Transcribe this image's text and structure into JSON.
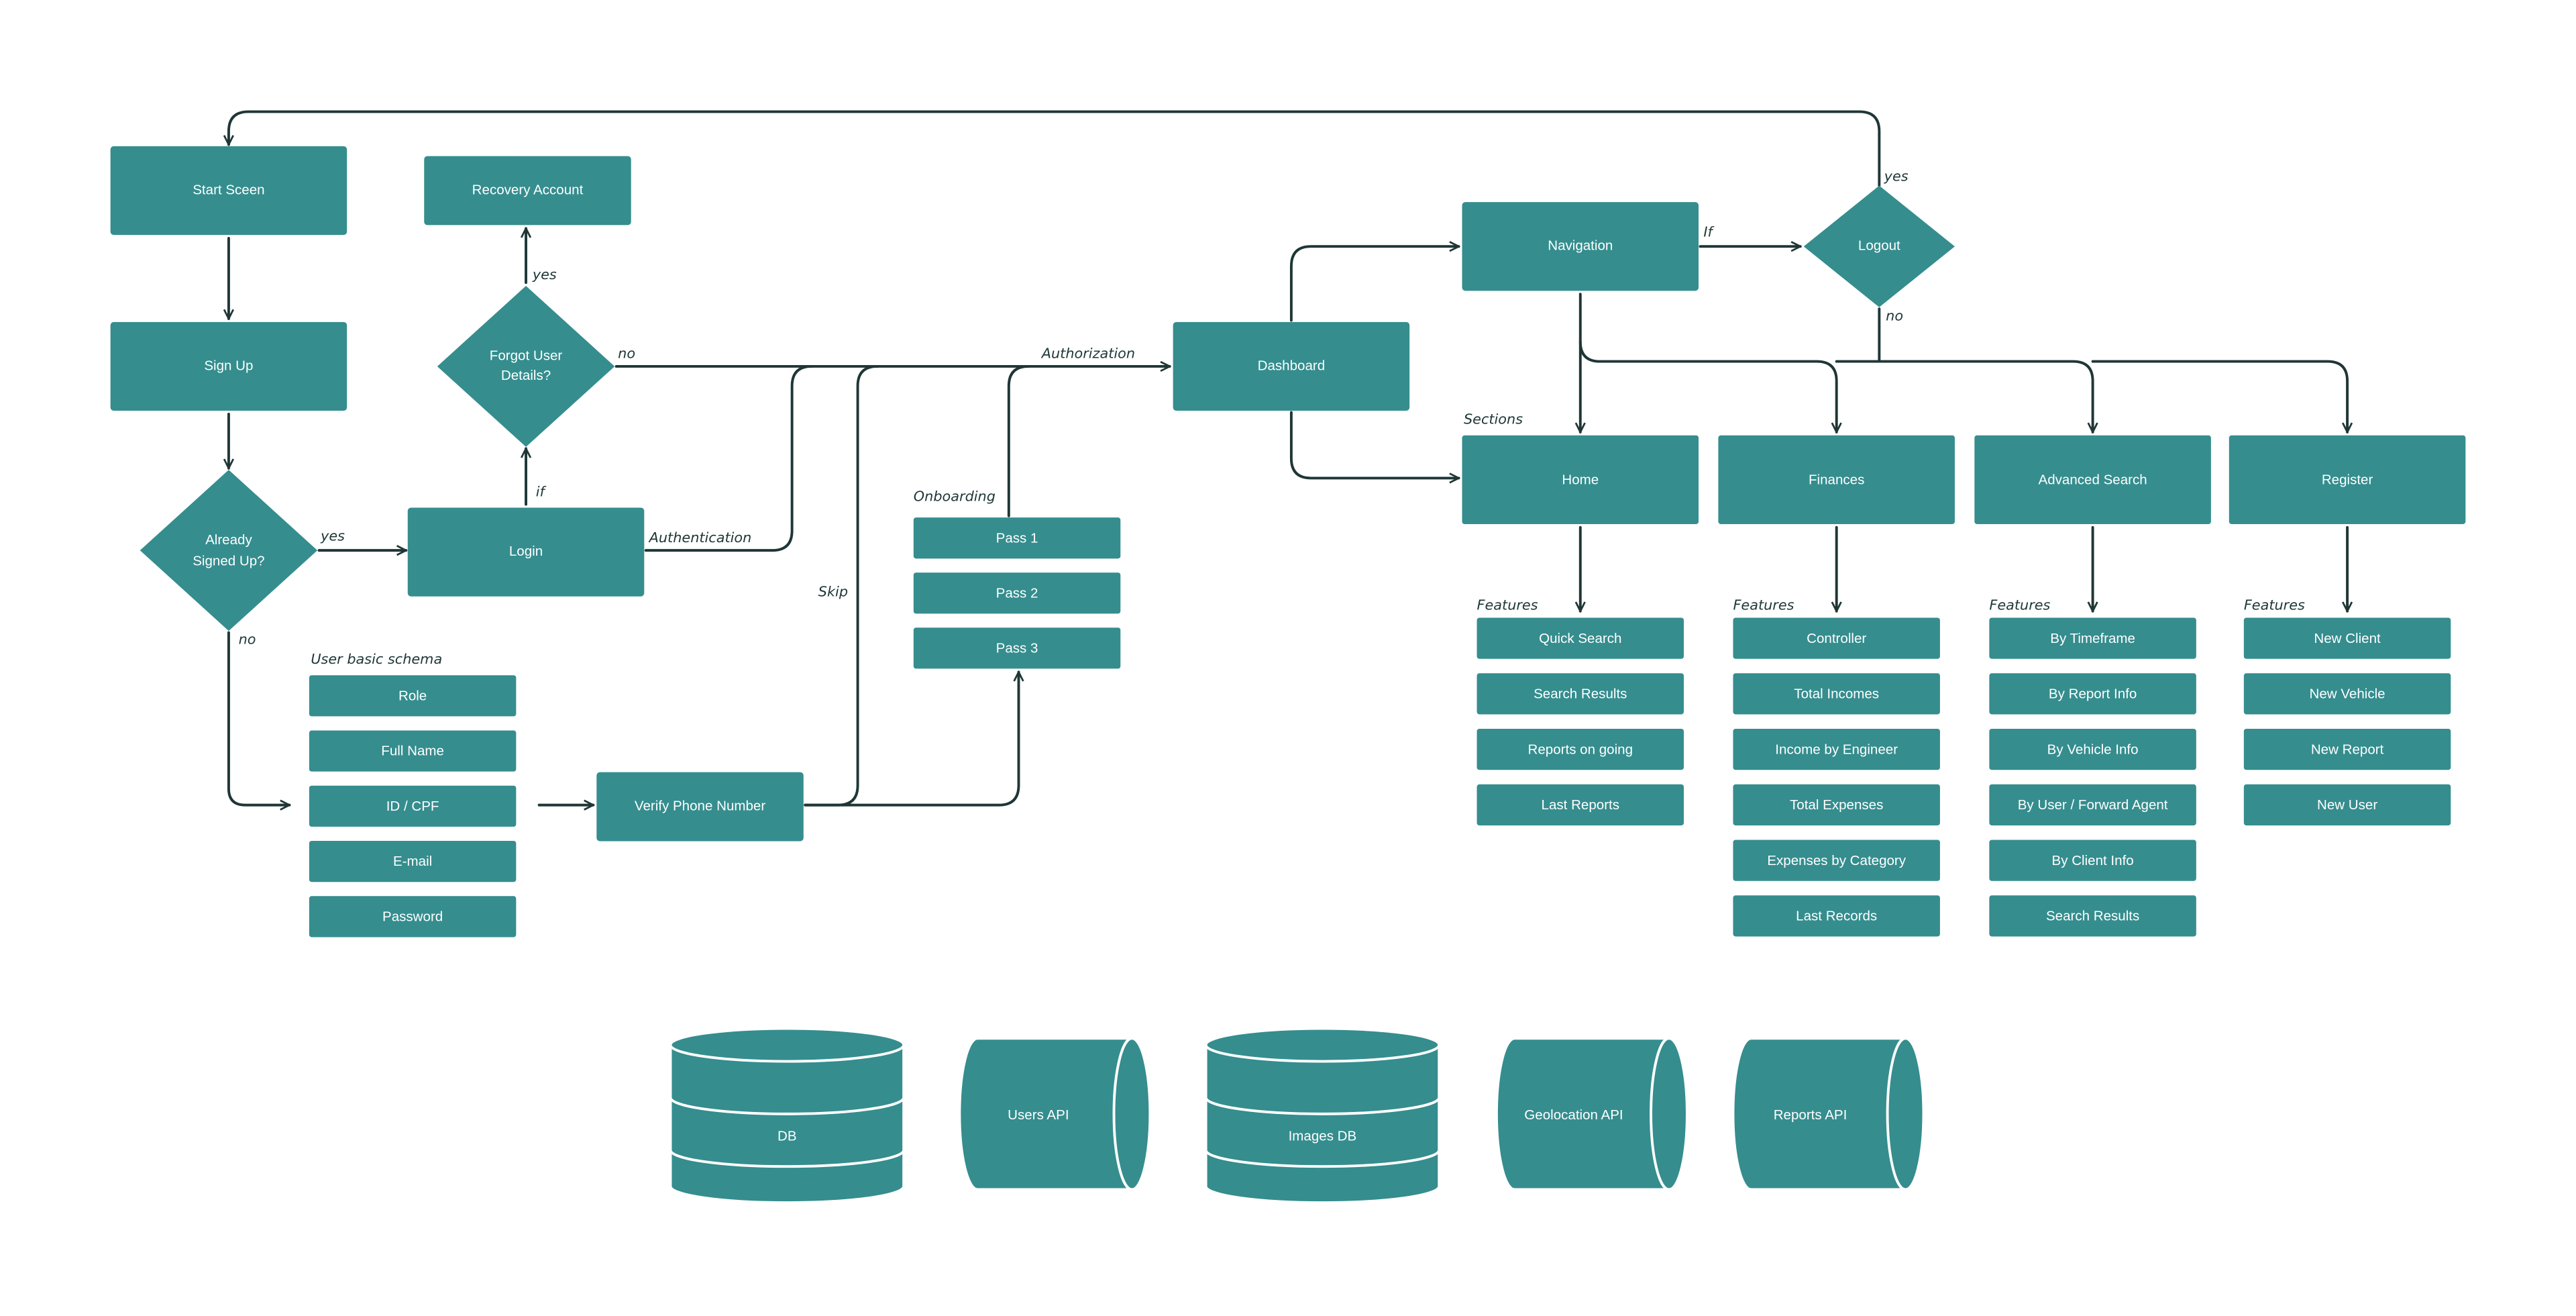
{
  "colors": {
    "node": "#358d8e",
    "line": "#1f3636",
    "background": "#ffffff"
  },
  "nodes": {
    "start": "Start Sceen",
    "signup": "Sign Up",
    "recovery": "Recovery Account",
    "forgot_1": "Forgot  User",
    "forgot_2": "Details?",
    "already_1": "Already",
    "already_2": "Signed Up?",
    "login": "Login",
    "verify": "Verify Phone Number",
    "dashboard": "Dashboard",
    "navigation": "Navigation",
    "logout": "Logout"
  },
  "schema": {
    "label": "User basic schema",
    "fields": [
      "Role",
      "Full Name",
      "ID / CPF",
      "E-mail",
      "Password"
    ]
  },
  "onboarding": {
    "label": "Onboarding",
    "steps": [
      "Pass 1",
      "Pass 2",
      "Pass 3"
    ]
  },
  "edge_labels": {
    "yes_recovery": "yes",
    "if_login": "if",
    "no_forgot": "no",
    "yes_already": "yes",
    "no_already": "no",
    "authentication": "Authentication",
    "skip": "Skip",
    "authorization": "Authorization",
    "if_nav": "If",
    "yes_logout": "yes",
    "no_logout": "no"
  },
  "sections": {
    "label": "Sections",
    "features_label": "Features",
    "items": [
      {
        "title": "Home",
        "features": [
          "Quick Search",
          "Search Results",
          "Reports on going",
          "Last Reports"
        ]
      },
      {
        "title": "Finances",
        "features": [
          "Controller",
          "Total Incomes",
          "Income by Engineer",
          "Total Expenses",
          "Expenses by Category",
          "Last Records"
        ]
      },
      {
        "title": "Advanced Search",
        "features": [
          "By Timeframe",
          "By Report Info",
          "By Vehicle Info",
          "By User / Forward Agent",
          "By Client Info",
          "Search Results"
        ]
      },
      {
        "title": "Register",
        "features": [
          "New Client",
          "New Vehicle",
          "New Report",
          "New User"
        ]
      }
    ]
  },
  "storage": {
    "db": "DB",
    "users_api": "Users API",
    "images_db": "Images DB",
    "geolocation_api": "Geolocation API",
    "reports_api": "Reports API"
  }
}
